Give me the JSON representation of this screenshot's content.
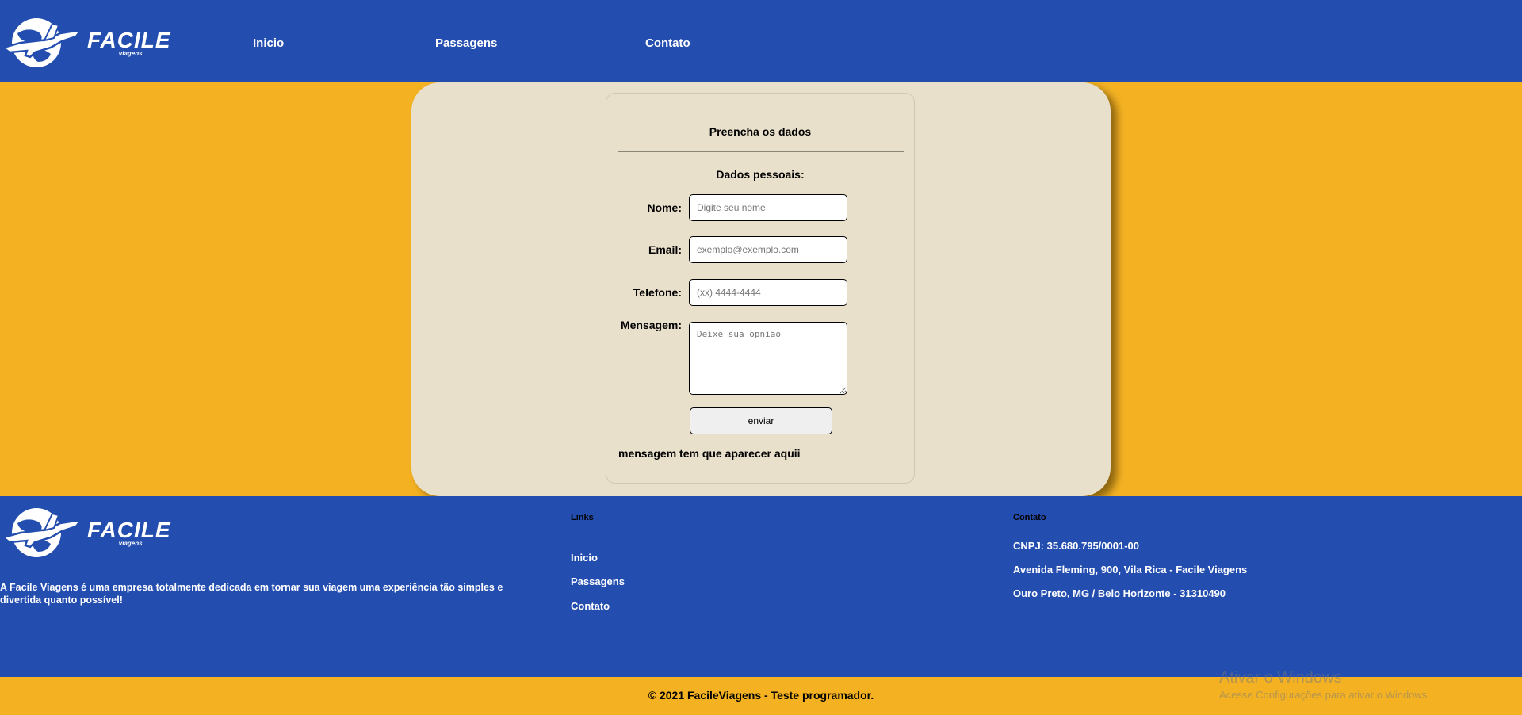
{
  "header": {
    "logo": {
      "name": "FACILE",
      "sub": "viagens",
      "icon": "globe-airplane-icon"
    },
    "nav": [
      {
        "label": "Inicio"
      },
      {
        "label": "Passagens"
      },
      {
        "label": "Contato"
      }
    ]
  },
  "form": {
    "title": "Preencha os dados",
    "section_title": "Dados pessoais:",
    "fields": {
      "nome": {
        "label": "Nome:",
        "placeholder": "Digite seu nome",
        "value": ""
      },
      "email": {
        "label": "Email:",
        "placeholder": "exemplo@exemplo.com",
        "value": ""
      },
      "telefone": {
        "label": "Telefone:",
        "placeholder": "(xx) 4444-4444",
        "value": ""
      },
      "mensagem": {
        "label": "Mensagem:",
        "placeholder": "Deixe sua opnião",
        "value": ""
      }
    },
    "submit_label": "enviar",
    "message": "mensagem tem que aparecer aquii"
  },
  "footer": {
    "logo": {
      "name": "FACILE",
      "sub": "viagens"
    },
    "description": "A Facile Viagens é uma empresa totalmente dedicada em tornar sua viagem uma experiência tão simples e divertida quanto possível!",
    "links_heading": "Links",
    "links": [
      {
        "label": "Inicio"
      },
      {
        "label": "Passagens"
      },
      {
        "label": "Contato"
      }
    ],
    "contact_heading": "Contato",
    "contact": [
      "CNPJ: 35.680.795/0001-00",
      "Avenida Fleming, 900, Vila Rica - Facile Viagens",
      "Ouro Preto, MG / Belo Horizonte - 31310490"
    ]
  },
  "copyright": "© 2021 FacileViagens - Teste programador.",
  "watermark": {
    "line1": "Ativar o Windows",
    "line2": "Acesse Configurações para ativar o Windows."
  },
  "colors": {
    "header_blue": "#234eb0",
    "accent_yellow": "#f4b223",
    "panel_beige": "#e9e0cb"
  }
}
